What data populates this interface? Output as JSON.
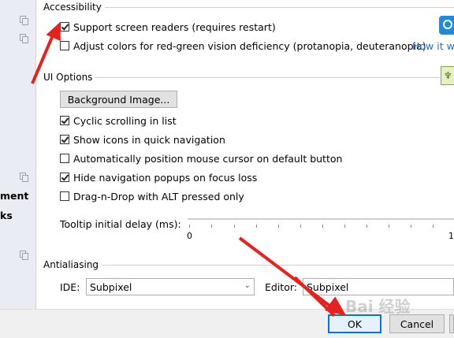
{
  "sidebar": {
    "items": [
      {
        "label": ""
      },
      {
        "label": ""
      },
      {
        "label": "ment"
      },
      {
        "label": "ks"
      }
    ]
  },
  "accessibility": {
    "title": "Accessibility",
    "options": [
      {
        "label": "Support screen readers (requires restart)",
        "checked": true
      },
      {
        "label": "Adjust colors for red-green vision deficiency (protanopia, deuteranopia)",
        "checked": false
      }
    ],
    "how_link": "How it wo"
  },
  "ui_options": {
    "title": "UI Options",
    "background_button": "Background Image...",
    "options": [
      {
        "label": "Cyclic scrolling in list",
        "checked": true
      },
      {
        "label": "Show icons in quick navigation",
        "checked": true
      },
      {
        "label": "Automatically position mouse cursor on default button",
        "checked": false
      },
      {
        "label": "Hide navigation popups on focus loss",
        "checked": true
      },
      {
        "label": "Drag-n-Drop with ALT pressed only",
        "checked": false
      }
    ],
    "tooltip_label": "Tooltip initial delay (ms):",
    "slider_min": "0",
    "slider_max": "1"
  },
  "antialiasing": {
    "title": "Antialiasing",
    "ide_label": "IDE:",
    "ide_value": "Subpixel",
    "editor_label": "Editor:",
    "editor_value": "Subpixel"
  },
  "footer": {
    "ok_label": "OK",
    "cancel_label": "Cancel"
  },
  "watermark": "Bai 经验",
  "colors": {
    "annotation_arrow": "#e8201e",
    "link": "#2a6ebb",
    "ok_border": "#0078d7"
  }
}
